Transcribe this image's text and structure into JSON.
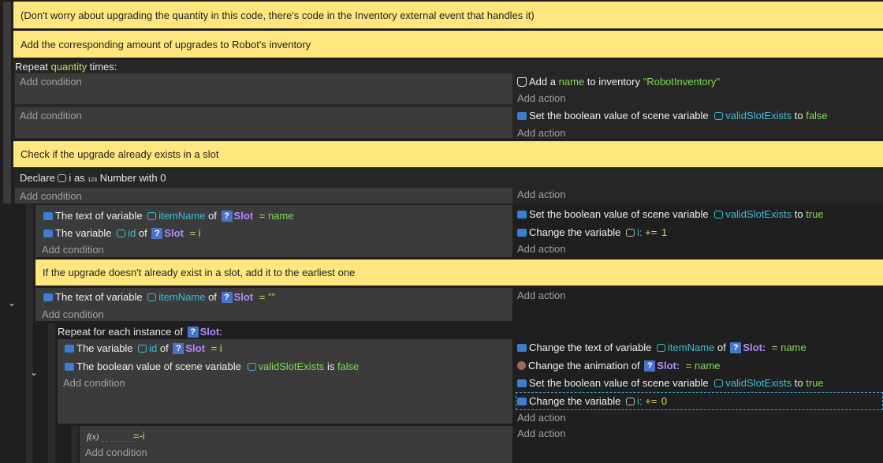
{
  "comments": [
    "(Don't worry about upgrading the quantity in this code, there's code in the Inventory external event that handles it)",
    "Add the corresponding amount of upgrades to Robot's inventory",
    "Check if the upgrade already exists in a slot",
    "If the upgrade doesn't already exist in a slot, add it to the earliest one"
  ],
  "repeat": {
    "prefix": "Repeat",
    "var": "quantity",
    "suffix": "times:"
  },
  "add_condition": "Add condition",
  "add_action": "Add action",
  "e1": {
    "a1": {
      "pre": "Add a",
      "name": "name",
      "mid": "to inventory",
      "str": "\"RobotInventory\""
    }
  },
  "e2": {
    "a1": {
      "pre": "Set the boolean value of scene variable",
      "var": "validSlotExists",
      "to": "to",
      "val": "false"
    }
  },
  "declare": {
    "pre": "Declare",
    "var": "i",
    "as": "as",
    "type_icon": "123",
    "type": "Number",
    "with": "with",
    "val": "0"
  },
  "e4": {
    "c1": {
      "pre": "The text of variable",
      "var": "itemName",
      "of": "of",
      "obj": "Slot",
      "op": "=",
      "val": "name"
    },
    "c2": {
      "pre": "The variable",
      "var": "id",
      "of": "of",
      "obj": "Slot",
      "op": "=",
      "val": "i"
    },
    "a1": {
      "pre": "Set the boolean value of scene variable",
      "var": "validSlotExists",
      "to": "to",
      "val": "true"
    },
    "a2": {
      "pre": "Change the variable",
      "var": "i:",
      "op": "+=",
      "val": "1"
    }
  },
  "e5": {
    "c1": {
      "pre": "The text of variable",
      "var": "itemName",
      "of": "of",
      "obj": "Slot",
      "op": "=",
      "val": "\"\""
    }
  },
  "foreach": {
    "pre": "Repeat for each instance of",
    "obj": "Slot",
    "suffix": ":"
  },
  "e6": {
    "c1": {
      "pre": "The variable",
      "var": "id",
      "of": "of",
      "obj": "Slot",
      "op": "=",
      "val": "i"
    },
    "c2": {
      "pre": "The boolean value of scene variable",
      "var": "validSlotExists",
      "is": "is",
      "val": "false"
    },
    "a1": {
      "pre": "Change the text of variable",
      "var": "itemName",
      "of": "of",
      "obj": "Slot:",
      "op": "=",
      "val": "name"
    },
    "a2": {
      "pre": "Change the animation of",
      "obj": "Slot:",
      "op": "=",
      "val": "name"
    },
    "a3": {
      "pre": "Set the boolean value of scene variable",
      "var": "validSlotExists",
      "to": "to",
      "val": "true"
    },
    "a4": {
      "pre": "Change the variable",
      "var": "i:",
      "op": "+=",
      "val": "0"
    }
  },
  "e7": {
    "fx": "f(x)",
    "expr": "=-i"
  },
  "colors": {
    "comment": "#ffe67f",
    "event_bg": "#3b3b3b",
    "keyword_yellow": "#d8d36a",
    "value_green": "#7edc55",
    "variable_cyan": "#3fbcd6",
    "object_purple": "#b38cff"
  }
}
